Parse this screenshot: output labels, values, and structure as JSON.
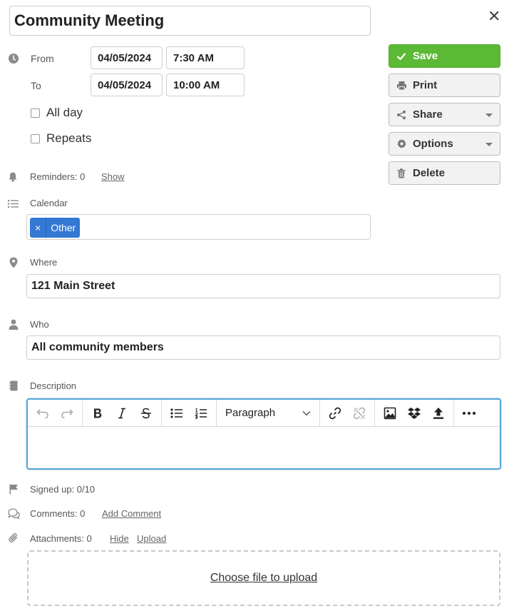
{
  "event": {
    "title": "Community Meeting"
  },
  "dates": {
    "from_label": "From",
    "to_label": "To",
    "from_date": "04/05/2024",
    "from_time": "7:30 AM",
    "to_date": "04/05/2024",
    "to_time": "10:00 AM",
    "all_day_label": "All day",
    "repeats_label": "Repeats"
  },
  "actions": {
    "save": "Save",
    "print": "Print",
    "share": "Share",
    "options": "Options",
    "delete": "Delete"
  },
  "reminders": {
    "label": "Reminders: 0",
    "show_link": "Show"
  },
  "calendar": {
    "label": "Calendar",
    "tags": [
      "Other"
    ],
    "tag_remove": "×",
    "tag_color": "#3478d4"
  },
  "where": {
    "label": "Where",
    "value": "121 Main Street"
  },
  "who": {
    "label": "Who",
    "value": "All community members"
  },
  "description": {
    "label": "Description",
    "format_select": "Paragraph",
    "content": ""
  },
  "signed_up": {
    "label": "Signed up: 0/10"
  },
  "comments": {
    "label": "Comments: 0",
    "add_link": "Add Comment"
  },
  "attachments": {
    "label": "Attachments: 0",
    "hide_link": "Hide",
    "upload_link": "Upload",
    "dropzone": "Choose file to upload"
  },
  "colors": {
    "save": "#5cb935",
    "tag": "#3478d4",
    "editor_focus": "#5aa6d6"
  },
  "icons": [
    "close-icon",
    "clock-icon",
    "bell-icon",
    "list-icon",
    "map-pin-icon",
    "person-icon",
    "notebook-icon",
    "flag-icon",
    "comments-icon",
    "paperclip-icon",
    "check-icon",
    "printer-icon",
    "share-icon",
    "gear-icon",
    "trash-icon"
  ]
}
